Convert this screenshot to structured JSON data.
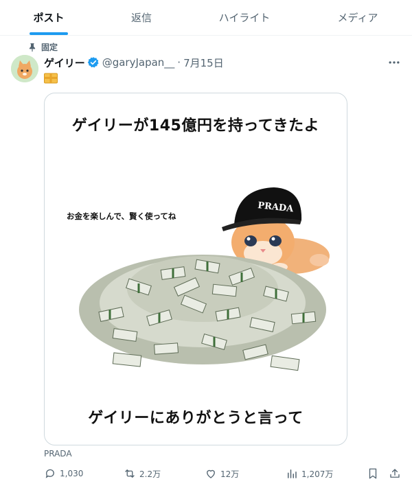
{
  "tabs": [
    {
      "label": "ポスト",
      "active": true
    },
    {
      "label": "返信",
      "active": false
    },
    {
      "label": "ハイライト",
      "active": false
    },
    {
      "label": "メディア",
      "active": false
    }
  ],
  "post": {
    "pinned_label": "固定",
    "author_name": "ゲイリー",
    "handle": "@garyJapan__",
    "separator": "·",
    "date": "7月15日",
    "text_emoji": "money-bag-box",
    "image": {
      "title": "ゲイリーが145億円を持ってきたよ",
      "subtitle": "お金を楽しんで、賢く使ってね",
      "bottom": "ゲイリーにありがとうと言って",
      "cap_text": "PRADA"
    },
    "source_label": "PRADA",
    "actions": {
      "replies": "1,030",
      "reposts": "2.2万",
      "likes": "12万",
      "views": "1,207万"
    }
  },
  "colors": {
    "accent": "#1d9bf0",
    "muted": "#536471",
    "text": "#0f1419",
    "border": "#cfd9de"
  }
}
